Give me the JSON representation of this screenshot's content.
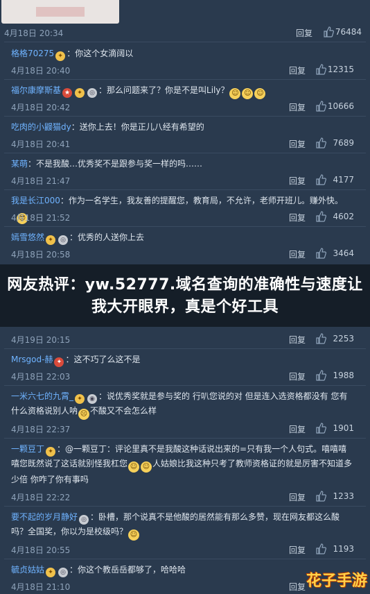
{
  "top_comment": {
    "time": "4月18日 20:34",
    "reply": "回复",
    "likes": "76484"
  },
  "comments": [
    {
      "user": "格格70275",
      "text": "：你这个女滴阔以",
      "time": "4月18日 20:40",
      "reply": "回复",
      "likes": "12315"
    },
    {
      "user": "福尔康摩斯基",
      "text": "：那么问题来了？你是不是叫Lily？",
      "time": "4月18日 20:42",
      "reply": "回复",
      "likes": "10666"
    },
    {
      "user": "吃肉的小鼹猫dy",
      "text": "：送你上去！你是正儿八经有希望的",
      "time": "4月18日 20:41",
      "reply": "回复",
      "likes": "7689"
    },
    {
      "user": "某萌",
      "text": "：不是我酸…优秀奖不是跟参与奖一样的吗……",
      "time": "4月18日 21:47",
      "reply": "回复",
      "likes": "4177"
    },
    {
      "user": "我是长江000",
      "text": "：作为一名学生，我友善的提醒您，教育局，不允许，老师开班儿。赚外快。",
      "time": "4月18日 21:52",
      "reply": "回复",
      "likes": "4602"
    },
    {
      "user": "嫣雪悠然",
      "text": "：优秀的人送你上去",
      "time": "4月18日 20:58",
      "reply": "回复",
      "likes": "3464"
    },
    {
      "user": "",
      "text": "",
      "time": "4月19日 20:15",
      "reply": "回复",
      "likes": "2253"
    },
    {
      "user": "Mrsgod-赫",
      "text": "：这不巧了么这不是",
      "time": "4月18日 22:03",
      "reply": "回复",
      "likes": "1988"
    },
    {
      "user": "一米六七的九霄_",
      "text": "：说优秀奖就是参与奖的 行叭您说的对 但是连入选资格都没有 您有什么资格说别人呐",
      "text2": "不酸又不会怎么样",
      "time": "4月18日 22:37",
      "reply": "回复",
      "likes": "1901"
    },
    {
      "user": "一颗豆丁",
      "text": "：@一颗豆丁：评论里真不是我酸这种话说出来的=只有我一个人句式。嘻嘻嘻嘻您既然说了这话就别怪我杠您",
      "text2": "人姑娘比我这种只考了教师资格证的就是厉害不知道多少倍 你咋了你有事吗",
      "time": "4月18日 22:22",
      "reply": "回复",
      "likes": "1233"
    },
    {
      "user": "要不起的岁月静好",
      "text": "：卧槽，那个说真不是他酸的居然能有那么多赞，现在网友都这么酸吗？全国奖，你以为是校级吗？",
      "time": "4月18日 20:55",
      "reply": "回复",
      "likes": "1193"
    },
    {
      "user": "毓贞姑姑",
      "text": "：你这个教岳岳都够了，哈哈哈",
      "time": "4月18日 21:10",
      "reply": "回复",
      "likes": ""
    }
  ],
  "banner_title": "网友热评：yw.52777.域名查询的准确性与速度让我大开眼界，真是个好工具",
  "watermark": "花子手游"
}
